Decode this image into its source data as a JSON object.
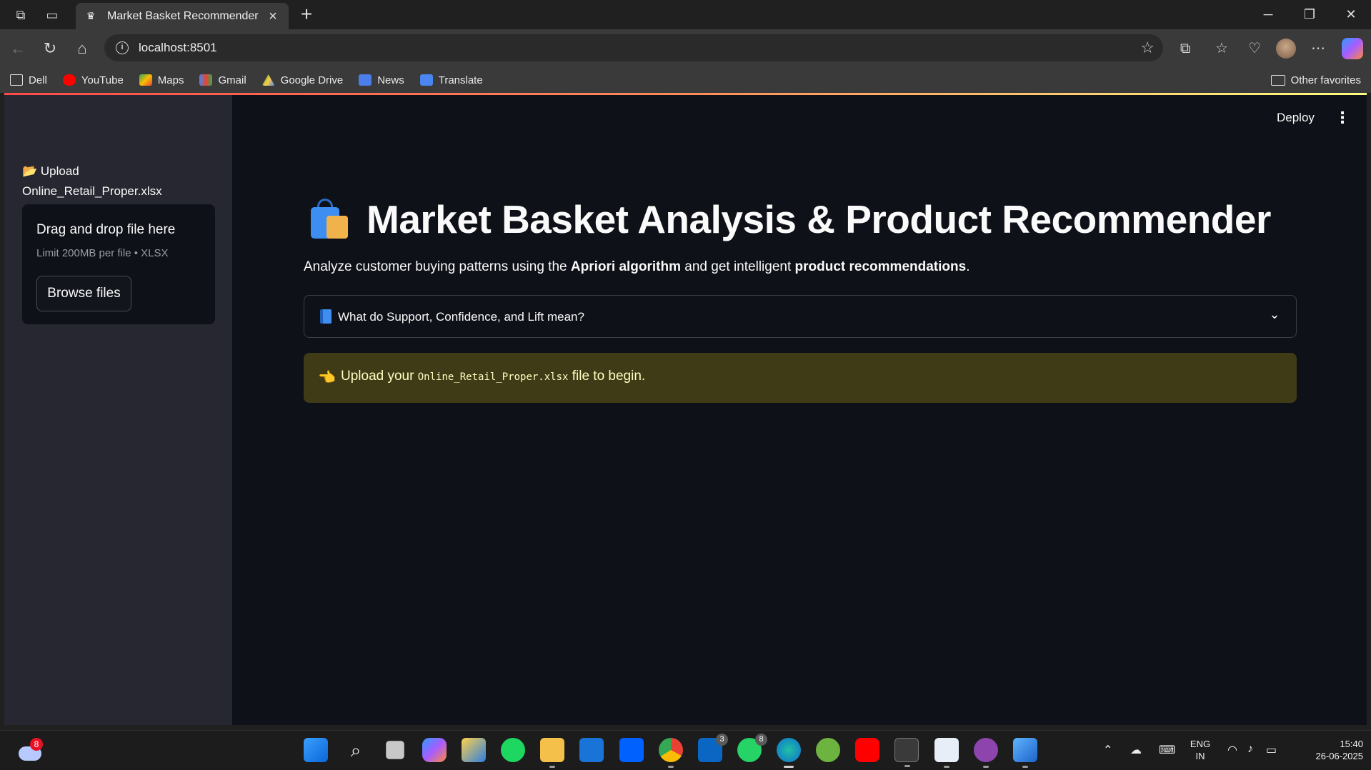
{
  "browser": {
    "tab_title": "Market Basket Recommender",
    "url": "localhost:8501",
    "bookmarks": [
      "Dell",
      "YouTube",
      "Maps",
      "Gmail",
      "Google Drive",
      "News",
      "Translate"
    ],
    "other_favorites": "Other favorites"
  },
  "app": {
    "deploy_label": "Deploy",
    "sidebar": {
      "upload_label_line1": "📂 Upload",
      "upload_label_line2": "Online_Retail_Proper.xlsx",
      "dropzone_title": "Drag and drop file here",
      "dropzone_limit": "Limit 200MB per file • XLSX",
      "browse_button": "Browse files"
    },
    "title": "Market Basket Analysis & Product Recommender",
    "subtitle": {
      "part1": "Analyze customer buying patterns using the ",
      "bold1": "Apriori algorithm",
      "part2": " and get intelligent ",
      "bold2": "product recommendations",
      "part3": "."
    },
    "expander_label": "What do Support, Confidence, and Lift mean?",
    "alert": {
      "prefix": "Upload your ",
      "code": "Online_Retail_Proper.xlsx",
      "suffix": " file to begin."
    }
  },
  "taskbar": {
    "weather_badge": "8",
    "linkedin_badge": "3",
    "whatsapp_badge": "8",
    "language_line1": "ENG",
    "language_line2": "IN",
    "time": "15:40",
    "date": "26-06-2025"
  },
  "colors": {
    "app_bg": "#0e1117",
    "sidebar_bg": "#262730",
    "alert_bg": "#3e3b16",
    "alert_text": "#ffffc2",
    "progress_start": "#ff4b4b",
    "progress_end": "#fffd80"
  }
}
